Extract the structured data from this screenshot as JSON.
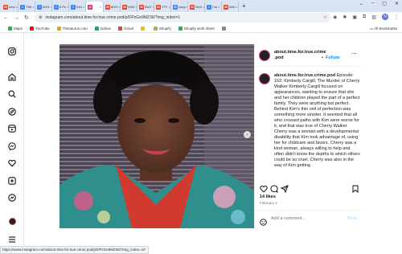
{
  "browser": {
    "tabs": [
      {
        "label": "Inbo",
        "icon": "gmail-icon",
        "color": "#ea4335",
        "glyph": "M"
      },
      {
        "label": "TWI",
        "icon": "doc-icon",
        "color": "#4285f4",
        "glyph": "≡"
      },
      {
        "label": "6001",
        "icon": "doc-icon",
        "color": "#4285f4",
        "glyph": "≡"
      },
      {
        "label": "8 Pe",
        "icon": "doc-icon",
        "color": "#4285f4",
        "glyph": "≡"
      },
      {
        "label": "Kim",
        "icon": "doc-icon",
        "color": "#4285f4",
        "glyph": "≡"
      },
      {
        "label": "",
        "icon": "instagram-icon",
        "color": "#d62976",
        "glyph": "◎",
        "active": true
      },
      {
        "label": "MVS",
        "icon": "gmail-icon",
        "color": "#ea4335",
        "glyph": "M"
      },
      {
        "label": "DNG",
        "icon": "gmail-icon",
        "color": "#ea4335",
        "glyph": "M"
      },
      {
        "label": "5307",
        "icon": "gmail-icon",
        "color": "#ea4335",
        "glyph": "M"
      },
      {
        "label": "YTF",
        "icon": "gmail-icon",
        "color": "#ea4335",
        "glyph": "M"
      },
      {
        "label": "cargi",
        "icon": "google-icon",
        "color": "#4285f4",
        "glyph": "G"
      },
      {
        "label": "Se2I",
        "icon": "gmail-icon",
        "color": "#ea4335",
        "glyph": "M"
      },
      {
        "label": "I've",
        "icon": "doc-icon",
        "color": "#4285f4",
        "glyph": "≡"
      },
      {
        "label": "Whi",
        "icon": "gmail-icon",
        "color": "#ea4335",
        "glyph": "M"
      }
    ],
    "url": "instagram.com/about.time.for.true.crime.pod/p/DPzGe9MZ36/?img_index=1",
    "profile_initial": "N",
    "bookmarks": [
      {
        "label": "Maps",
        "color": "#34a853"
      },
      {
        "label": "YouTube",
        "color": "#ff0000"
      },
      {
        "label": "Thesaurus.com",
        "color": "#f4a100"
      },
      {
        "label": "Gdrive",
        "color": "#1fa463"
      },
      {
        "label": "Gmail",
        "color": "#ea4335"
      },
      {
        "label": "",
        "color": "#fbbc04"
      },
      {
        "label": "Shopify",
        "color": "#95bf47"
      },
      {
        "label": "Shopify work sheet",
        "color": "#34a853"
      },
      {
        "label": "",
        "color": "#888888"
      }
    ],
    "all_bookmarks": "All Bookmarks",
    "status_url": "https://www.instagram.com/about.time.for.true.crime.pod/p/DPzGe9MZ36/?img_index=1#"
  },
  "post": {
    "username": "about.time.for.true.crime.pod",
    "username_line1": "about.time.for.true.crime",
    "username_line2": ".pod",
    "follow_sep": "•",
    "follow": "Follow",
    "caption_user": "about.time.for.true.crime.pod",
    "caption": "Episode 162: Kimberly Cargill, The Murder of Cherry Walker Kimberly Cargill focused on appearances, wanting to ensure that she and her children played the part of a perfect family. They were anything but perfect. Behind Kim's thin veil of perfection was something more sinister. It seemed that all who crossed paths with Kim were worse for it, and that was true of Cherry Walker. Cherry was a woman with a developmental disability that Kim took advantage of, using her for childcare and favors. Cherry was a kind woman, always willing to help and often didn't know the depths to which others could be so cruel. Cherry was also in the way of Kim getting",
    "likes": "14 likes",
    "date": "February 4",
    "comment_placeholder": "Add a comment...",
    "post_label": "Post"
  }
}
